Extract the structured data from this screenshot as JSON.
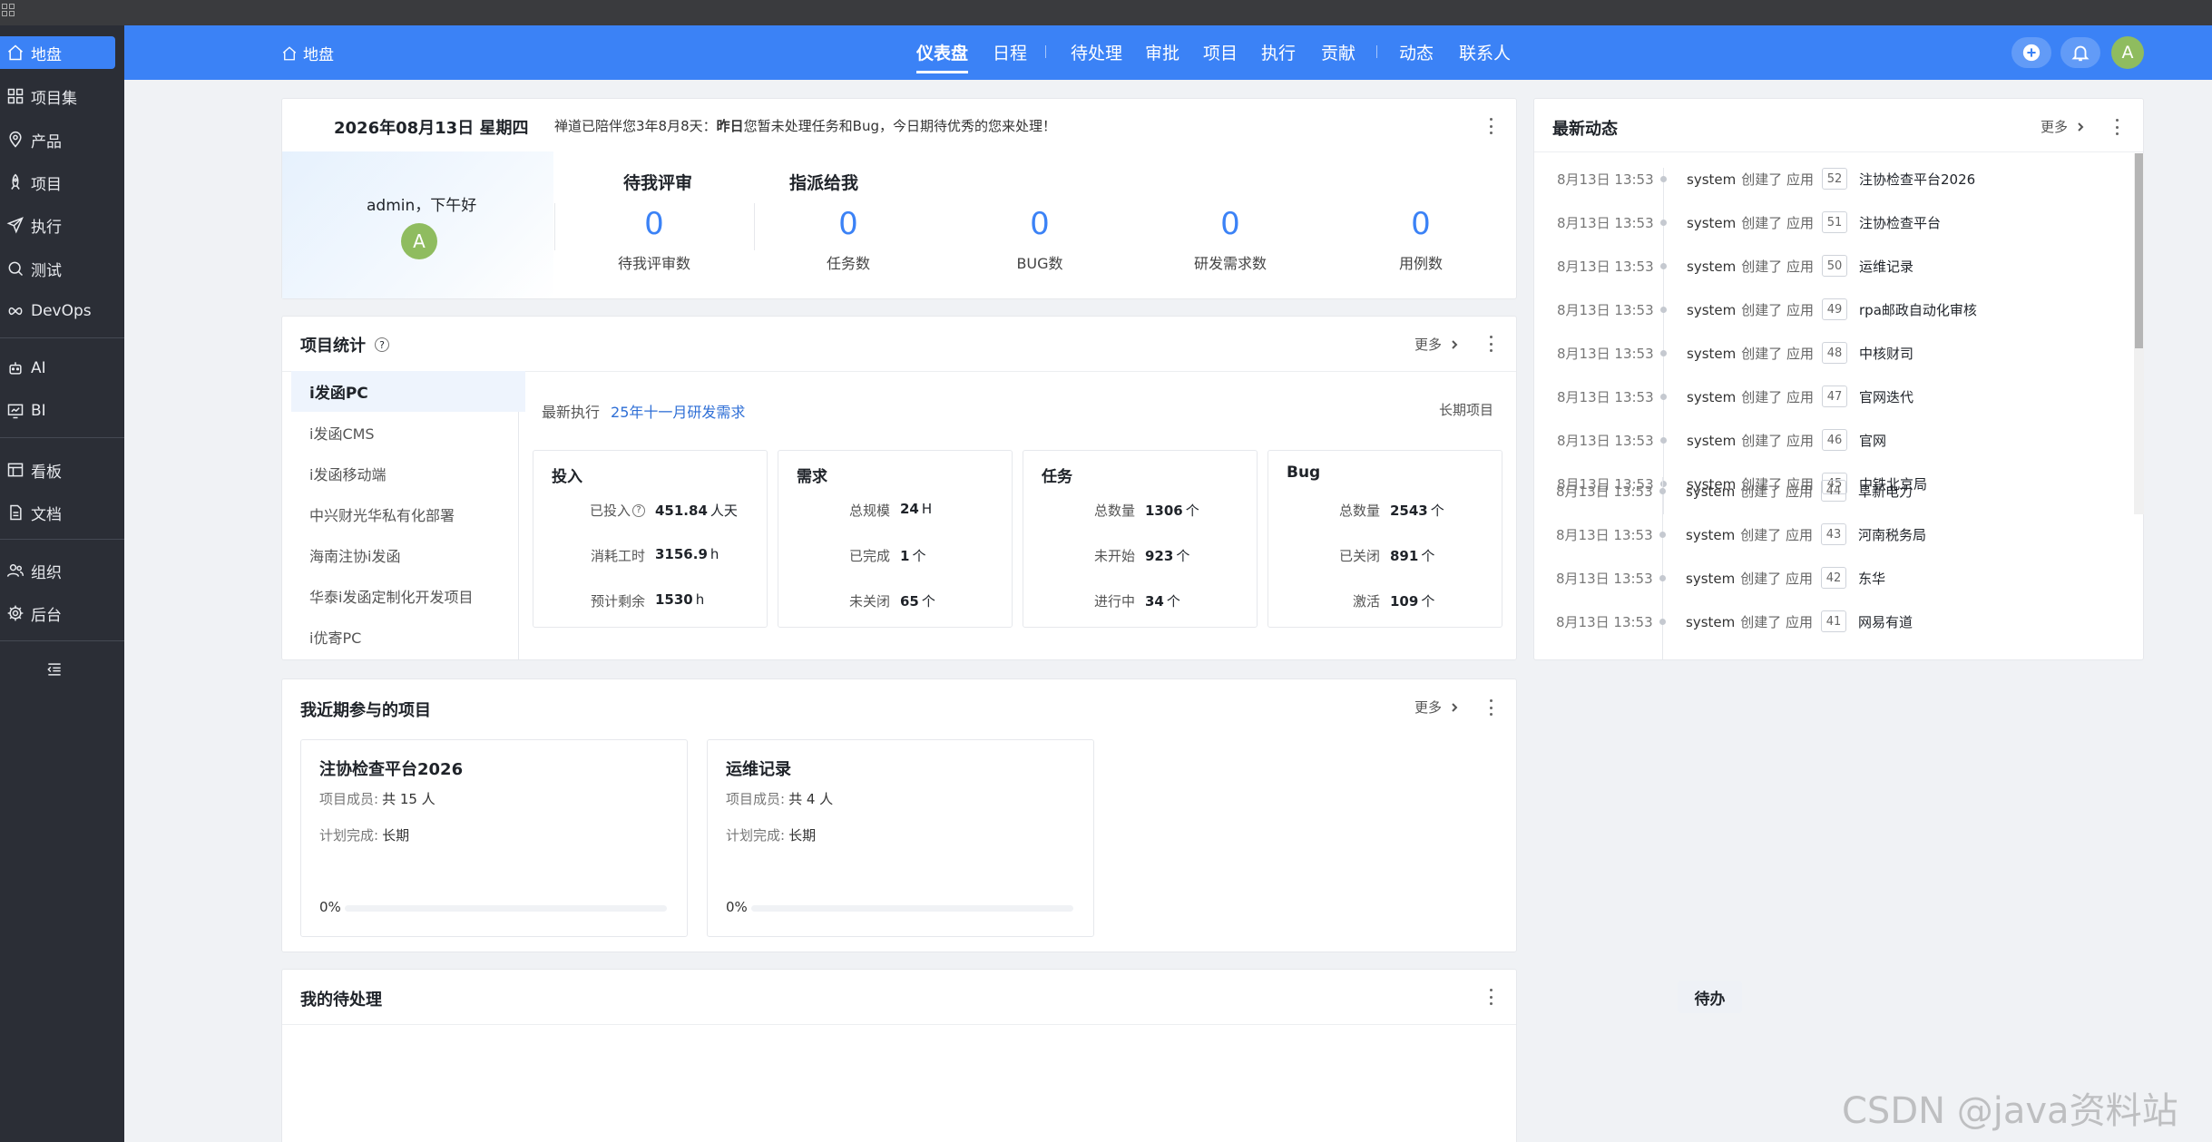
{
  "sidebar": {
    "items": [
      {
        "label": "地盘",
        "icon": "home-icon"
      },
      {
        "label": "项目集",
        "icon": "grid-icon"
      },
      {
        "label": "产品",
        "icon": "location-icon"
      },
      {
        "label": "项目",
        "icon": "rocket-icon"
      },
      {
        "label": "执行",
        "icon": "send-icon"
      },
      {
        "label": "测试",
        "icon": "search-icon"
      },
      {
        "label": "DevOps",
        "icon": "infinity-icon"
      },
      {
        "label": "AI",
        "icon": "robot-icon"
      },
      {
        "label": "BI",
        "icon": "chart-icon"
      },
      {
        "label": "看板",
        "icon": "board-icon"
      },
      {
        "label": "文档",
        "icon": "document-icon"
      },
      {
        "label": "组织",
        "icon": "users-icon"
      },
      {
        "label": "后台",
        "icon": "gear-icon"
      }
    ]
  },
  "topbar": {
    "breadcrumb": "地盘",
    "nav": [
      "仪表盘",
      "日程",
      "待处理",
      "审批",
      "项目",
      "执行",
      "贡献",
      "动态",
      "联系人"
    ],
    "avatar": "A"
  },
  "welcome": {
    "date": "2026年08月13日 星期四",
    "msg_prefix": "禅道已陪伴您3年8月8天：",
    "msg_bold": "昨日",
    "msg_suffix": "您暂未处理任务和Bug，今日期待优秀的您来处理！",
    "greeting": "admin，下午好",
    "avatar": "A",
    "head_review": "待我评审",
    "head_assigned": "指派给我",
    "stats": [
      {
        "value": "0",
        "label": "待我评审数"
      },
      {
        "value": "0",
        "label": "任务数"
      },
      {
        "value": "0",
        "label": "BUG数"
      },
      {
        "value": "0",
        "label": "研发需求数"
      },
      {
        "value": "0",
        "label": "用例数"
      }
    ]
  },
  "project_stats": {
    "title": "项目统计",
    "more": "更多",
    "projects": [
      "i发函PC",
      "i发函CMS",
      "i发函移动端",
      "中兴财光华私有化部署",
      "海南注协i发函",
      "华泰i发函定制化开发项目",
      "i优寄PC"
    ],
    "latest_label": "最新执行",
    "latest_value": "25年十一月研发需求",
    "long_term": "长期项目",
    "boxes": [
      {
        "title": "投入",
        "rows": [
          {
            "label": "已投入",
            "value": "451.84",
            "unit": "人天"
          },
          {
            "label": "消耗工时",
            "value": "3156.9",
            "unit": "h"
          },
          {
            "label": "预计剩余",
            "value": "1530",
            "unit": "h"
          }
        ]
      },
      {
        "title": "需求",
        "rows": [
          {
            "label": "总规模",
            "value": "24",
            "unit": "H"
          },
          {
            "label": "已完成",
            "value": "1",
            "unit": "个"
          },
          {
            "label": "未关闭",
            "value": "65",
            "unit": "个"
          }
        ]
      },
      {
        "title": "任务",
        "rows": [
          {
            "label": "总数量",
            "value": "1306",
            "unit": "个"
          },
          {
            "label": "未开始",
            "value": "923",
            "unit": "个"
          },
          {
            "label": "进行中",
            "value": "34",
            "unit": "个"
          }
        ]
      },
      {
        "title": "Bug",
        "rows": [
          {
            "label": "总数量",
            "value": "2543",
            "unit": "个"
          },
          {
            "label": "已关闭",
            "value": "891",
            "unit": "个"
          },
          {
            "label": "激活",
            "value": "109",
            "unit": "个"
          }
        ]
      }
    ]
  },
  "recent_projects": {
    "title": "我近期参与的项目",
    "more": "更多",
    "members_label": "项目成员:",
    "plan_label": "计划完成:",
    "items": [
      {
        "name": "注协检查平台2026",
        "members": "共 15 人",
        "plan": "长期",
        "progress": "0%",
        "progress_value": 0
      },
      {
        "name": "运维记录",
        "members": "共 4 人",
        "plan": "长期",
        "progress": "0%",
        "progress_value": 0
      }
    ]
  },
  "todo": {
    "title": "我的待处理",
    "tab": "待办"
  },
  "activity": {
    "title": "最新动态",
    "more": "更多",
    "items": [
      {
        "time": "8月13日 13:53",
        "user": "system",
        "action": "创建了 应用",
        "id": "52",
        "name": "注协检查平台2026"
      },
      {
        "time": "8月13日 13:53",
        "user": "system",
        "action": "创建了 应用",
        "id": "51",
        "name": "注协检查平台"
      },
      {
        "time": "8月13日 13:53",
        "user": "system",
        "action": "创建了 应用",
        "id": "50",
        "name": "运维记录"
      },
      {
        "time": "8月13日 13:53",
        "user": "system",
        "action": "创建了 应用",
        "id": "49",
        "name": "rpa邮政自动化审核"
      },
      {
        "time": "8月13日 13:53",
        "user": "system",
        "action": "创建了 应用",
        "id": "48",
        "name": "中核财司"
      },
      {
        "time": "8月13日 13:53",
        "user": "system",
        "action": "创建了 应用",
        "id": "47",
        "name": "官网迭代"
      },
      {
        "time": "8月13日 13:53",
        "user": "system",
        "action": "创建了 应用",
        "id": "46",
        "name": "官网"
      },
      {
        "time": "8月13日 13:53",
        "user": "system",
        "action": "创建了 应用",
        "id": "45",
        "name": "中铁北京局"
      },
      {
        "time": "8月13日 13:53",
        "user": "system",
        "action": "创建了 应用",
        "id": "44",
        "name": "阜新电力"
      },
      {
        "time": "8月13日 13:53",
        "user": "system",
        "action": "创建了 应用",
        "id": "43",
        "name": "河南税务局"
      },
      {
        "time": "8月13日 13:53",
        "user": "system",
        "action": "创建了 应用",
        "id": "42",
        "name": "东华"
      },
      {
        "time": "8月13日 13:53",
        "user": "system",
        "action": "创建了 应用",
        "id": "41",
        "name": "网易有道"
      }
    ]
  },
  "watermark": "CSDN @java资料站"
}
